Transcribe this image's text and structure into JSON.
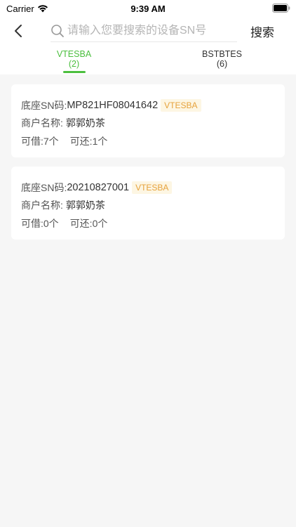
{
  "status_bar": {
    "carrier": "Carrier",
    "time": "9:39 AM"
  },
  "nav": {
    "search_placeholder": "请输入您要搜索的设备SN号",
    "search_value": "",
    "search_button": "搜索"
  },
  "tabs": [
    {
      "label": "VTESBA",
      "count": "(2)",
      "active": true
    },
    {
      "label": "BSTBTES",
      "count": "(6)",
      "active": false
    }
  ],
  "cards": [
    {
      "sn_label": "底座SN码:",
      "sn": "MP821HF08041642",
      "badge": "VTESBA",
      "merchant_label": "商户名称:",
      "merchant": "郭郭奶茶",
      "borrow_label": "可借:",
      "borrow": "7个",
      "return_label": "可还:",
      "return": "1个"
    },
    {
      "sn_label": "底座SN码:",
      "sn": "20210827001",
      "badge": "VTESBA",
      "merchant_label": "商户名称:",
      "merchant": "郭郭奶茶",
      "borrow_label": "可借:",
      "borrow": "0个",
      "return_label": "可还:",
      "return": "0个"
    }
  ],
  "colors": {
    "accent": "#4cbf3f",
    "badge_text": "#e6a23c",
    "badge_bg": "#fdf6e3",
    "background": "#f6f6f6"
  }
}
